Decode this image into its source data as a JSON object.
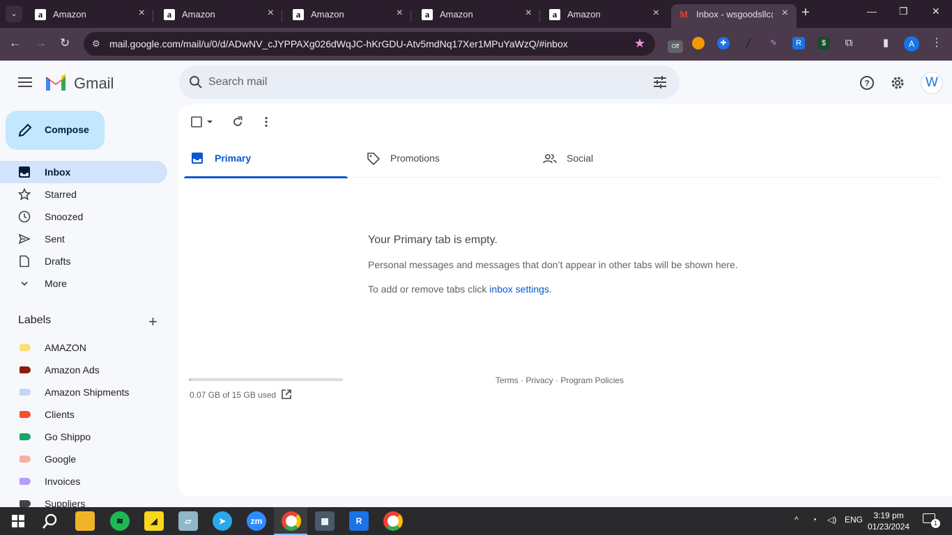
{
  "browser": {
    "tab_search_glyph": "⌄",
    "tabs": [
      {
        "title": "Amazon",
        "favicon": "a"
      },
      {
        "title": "Amazon",
        "favicon": "a"
      },
      {
        "title": "Amazon",
        "favicon": "a"
      },
      {
        "title": "Amazon",
        "favicon": "a"
      },
      {
        "title": "Amazon",
        "favicon": "a"
      },
      {
        "title": "Inbox - wsgoodsllc@",
        "favicon": "M"
      }
    ],
    "new_tab_glyph": "+",
    "window_controls": {
      "minimize": "—",
      "restore": "❐",
      "close": "✕"
    },
    "nav": {
      "back": "←",
      "forward": "→",
      "reload": "↻"
    },
    "url": "mail.google.com/mail/u/0/d/ADwNV_cJYPPAXg026dWqJC-hKrGDU-Atv5mdNq17Xer1MPuYaWzQ/#inbox",
    "bookmark_star": "★",
    "profile_initial": "A",
    "extension_badge": "Off"
  },
  "gmail": {
    "logo_text": "Gmail",
    "search_placeholder": "Search mail",
    "avatar_initial": "W",
    "compose_label": "Compose",
    "nav": [
      {
        "label": "Inbox",
        "icon": "inbox-icon",
        "active": true
      },
      {
        "label": "Starred",
        "icon": "star-icon"
      },
      {
        "label": "Snoozed",
        "icon": "clock-icon"
      },
      {
        "label": "Sent",
        "icon": "send-icon"
      },
      {
        "label": "Drafts",
        "icon": "draft-icon"
      },
      {
        "label": "More",
        "icon": "chevron-down-icon"
      }
    ],
    "labels_title": "Labels",
    "labels": [
      {
        "label": "AMAZON",
        "color": "#fdde74"
      },
      {
        "label": "Amazon Ads",
        "color": "#8a1c0a"
      },
      {
        "label": "Amazon Shipments",
        "color": "#c2d7f9"
      },
      {
        "label": "Clients",
        "color": "#fb4c2f"
      },
      {
        "label": "Go Shippo",
        "color": "#16a766"
      },
      {
        "label": "Google",
        "color": "#f6b0a5"
      },
      {
        "label": "Invoices",
        "color": "#b99aff"
      },
      {
        "label": "Suppliers",
        "color": "#434343"
      }
    ],
    "tabs": [
      {
        "label": "Primary",
        "icon": "inbox-icon",
        "active": true
      },
      {
        "label": "Promotions",
        "icon": "tag-icon"
      },
      {
        "label": "Social",
        "icon": "people-icon"
      }
    ],
    "empty": {
      "title": "Your Primary tab is empty.",
      "description": "Personal messages and messages that don’t appear in other tabs will be shown here.",
      "hint_prefix": "To add or remove tabs click ",
      "hint_link": "inbox settings",
      "hint_suffix": "."
    },
    "storage": {
      "text": "0.07 GB of 15 GB used",
      "used_fraction": 0.0047
    },
    "footer": "Terms · Privacy · Program Policies",
    "accent_color": "#0b57d0"
  },
  "taskbar": {
    "apps": [
      "start",
      "search",
      "file-explorer",
      "spotify",
      "sticky-notes",
      "snipping",
      "telegram",
      "zoom",
      "chrome",
      "calculator",
      "r-app",
      "chrome"
    ],
    "tray": {
      "caret": "^",
      "language": "ENG",
      "time": "3:19 pm",
      "date": "01/23/2024",
      "notifications": "1"
    }
  }
}
